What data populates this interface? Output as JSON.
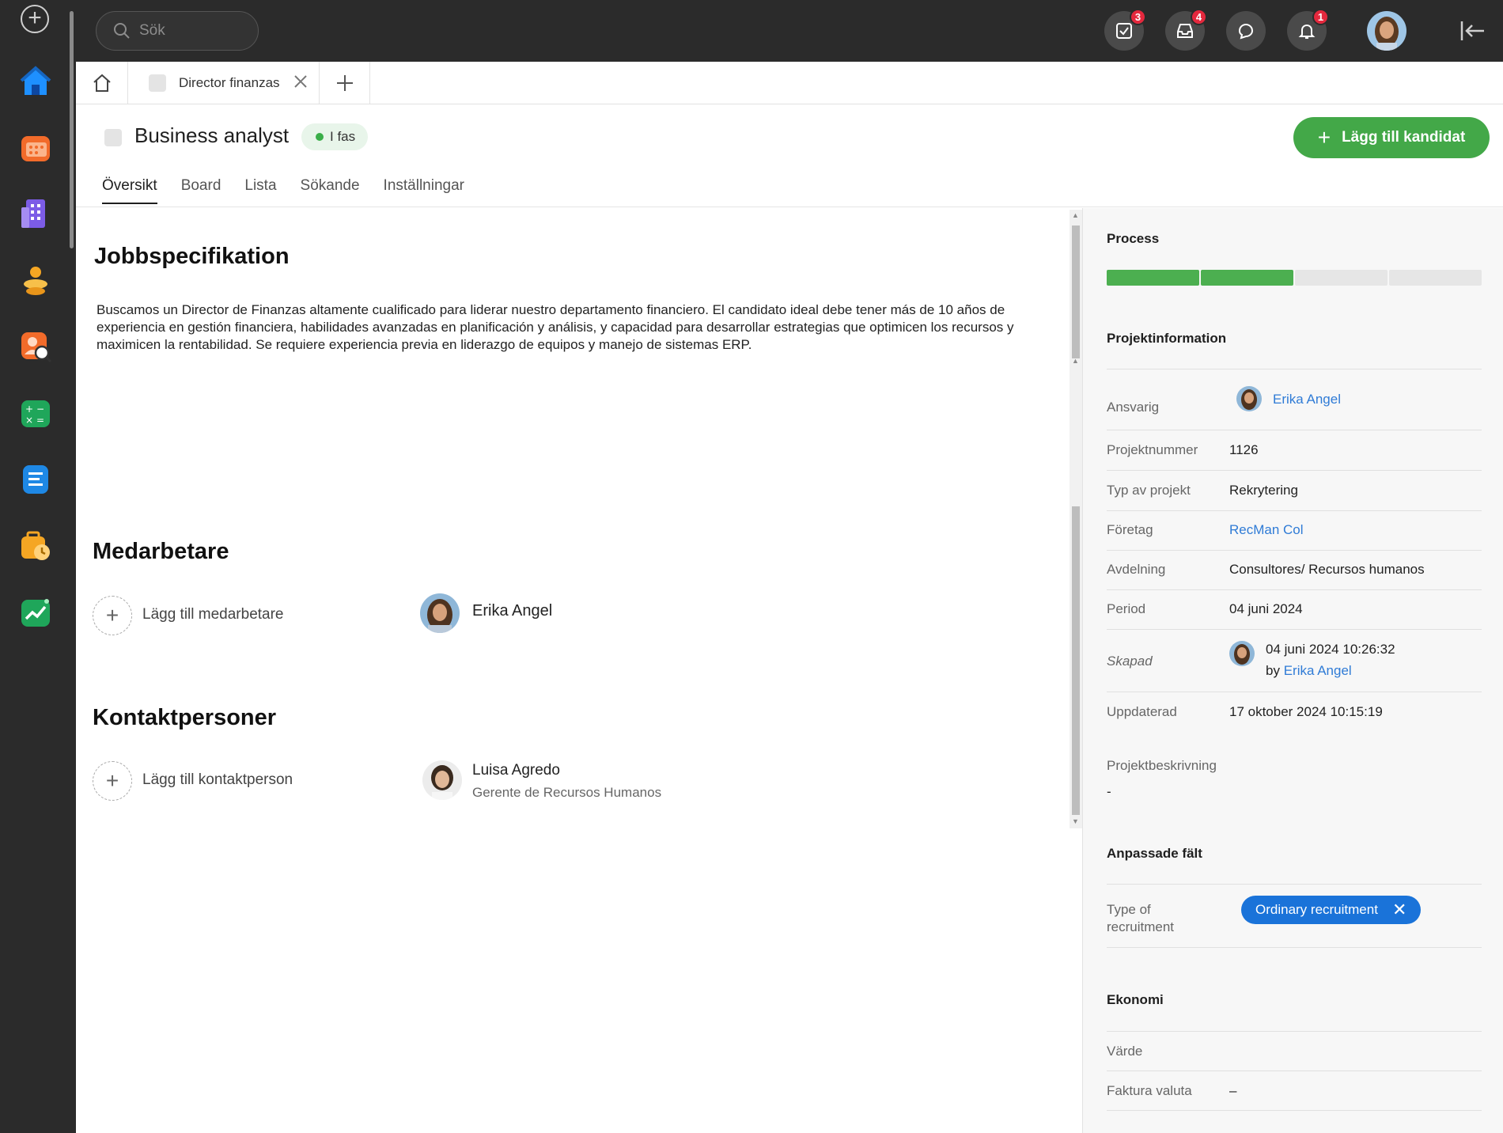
{
  "topbar": {
    "search_placeholder": "Sök",
    "badges": {
      "tasks": "3",
      "inbox": "4",
      "notifications": "1"
    }
  },
  "tabs": {
    "doc_tab_label": "Director finanzas"
  },
  "header": {
    "title": "Business analyst",
    "phase": "I fas",
    "add_candidate": "Lägg till kandidat",
    "subnav": [
      "Översikt",
      "Board",
      "Lista",
      "Sökande",
      "Inställningar"
    ]
  },
  "main": {
    "job_spec_title": "Jobbspecifikation",
    "job_spec_text": "Buscamos un Director de Finanzas altamente cualificado para liderar nuestro departamento financiero. El candidato ideal debe tener más de 10 años de experiencia en gestión financiera, habilidades avanzadas en planificación y análisis, y capacidad para desarrollar estrategias que optimicen los recursos y maximicen la rentabilidad. Se requiere experiencia previa en liderazgo de equipos y manejo de sistemas ERP.",
    "coworkers_title": "Medarbetare",
    "add_coworker": "Lägg till medarbetare",
    "coworker_name": "Erika Angel",
    "contacts_title": "Kontaktpersoner",
    "add_contact": "Lägg till kontaktperson",
    "contact_name": "Luisa Agredo",
    "contact_role": "Gerente de Recursos Humanos"
  },
  "side": {
    "process_title": "Process",
    "process_steps_done": 2,
    "process_steps_total": 4,
    "projinfo_title": "Projektinformation",
    "rows": {
      "responsible_label": "Ansvarig",
      "responsible_value": "Erika Angel",
      "projnum_label": "Projektnummer",
      "projnum_value": "1126",
      "type_label": "Typ av projekt",
      "type_value": "Rekrytering",
      "company_label": "Företag",
      "company_value": "RecMan Col",
      "dept_label": "Avdelning",
      "dept_value": "Consultores/ Recursos humanos",
      "period_label": "Period",
      "period_value": "04 juni 2024",
      "created_label": "Skapad",
      "created_value": "04 juni 2024 10:26:32",
      "created_by_prefix": "by",
      "created_by": "Erika Angel",
      "updated_label": "Uppdaterad",
      "updated_value": "17 oktober 2024 10:15:19",
      "desc_label": "Projektbeskrivning",
      "desc_value": "-"
    },
    "custom_title": "Anpassade fält",
    "custom_label": "Type of recruitment",
    "custom_chip": "Ordinary recruitment",
    "economy_title": "Ekonomi",
    "value_label": "Värde",
    "invoice_label": "Faktura valuta",
    "invoice_value": "–"
  },
  "colors": {
    "accent_green": "#43a848",
    "link_blue": "#2f7bd6",
    "chip_blue": "#1a73d9",
    "badge_red": "#e4283d"
  }
}
